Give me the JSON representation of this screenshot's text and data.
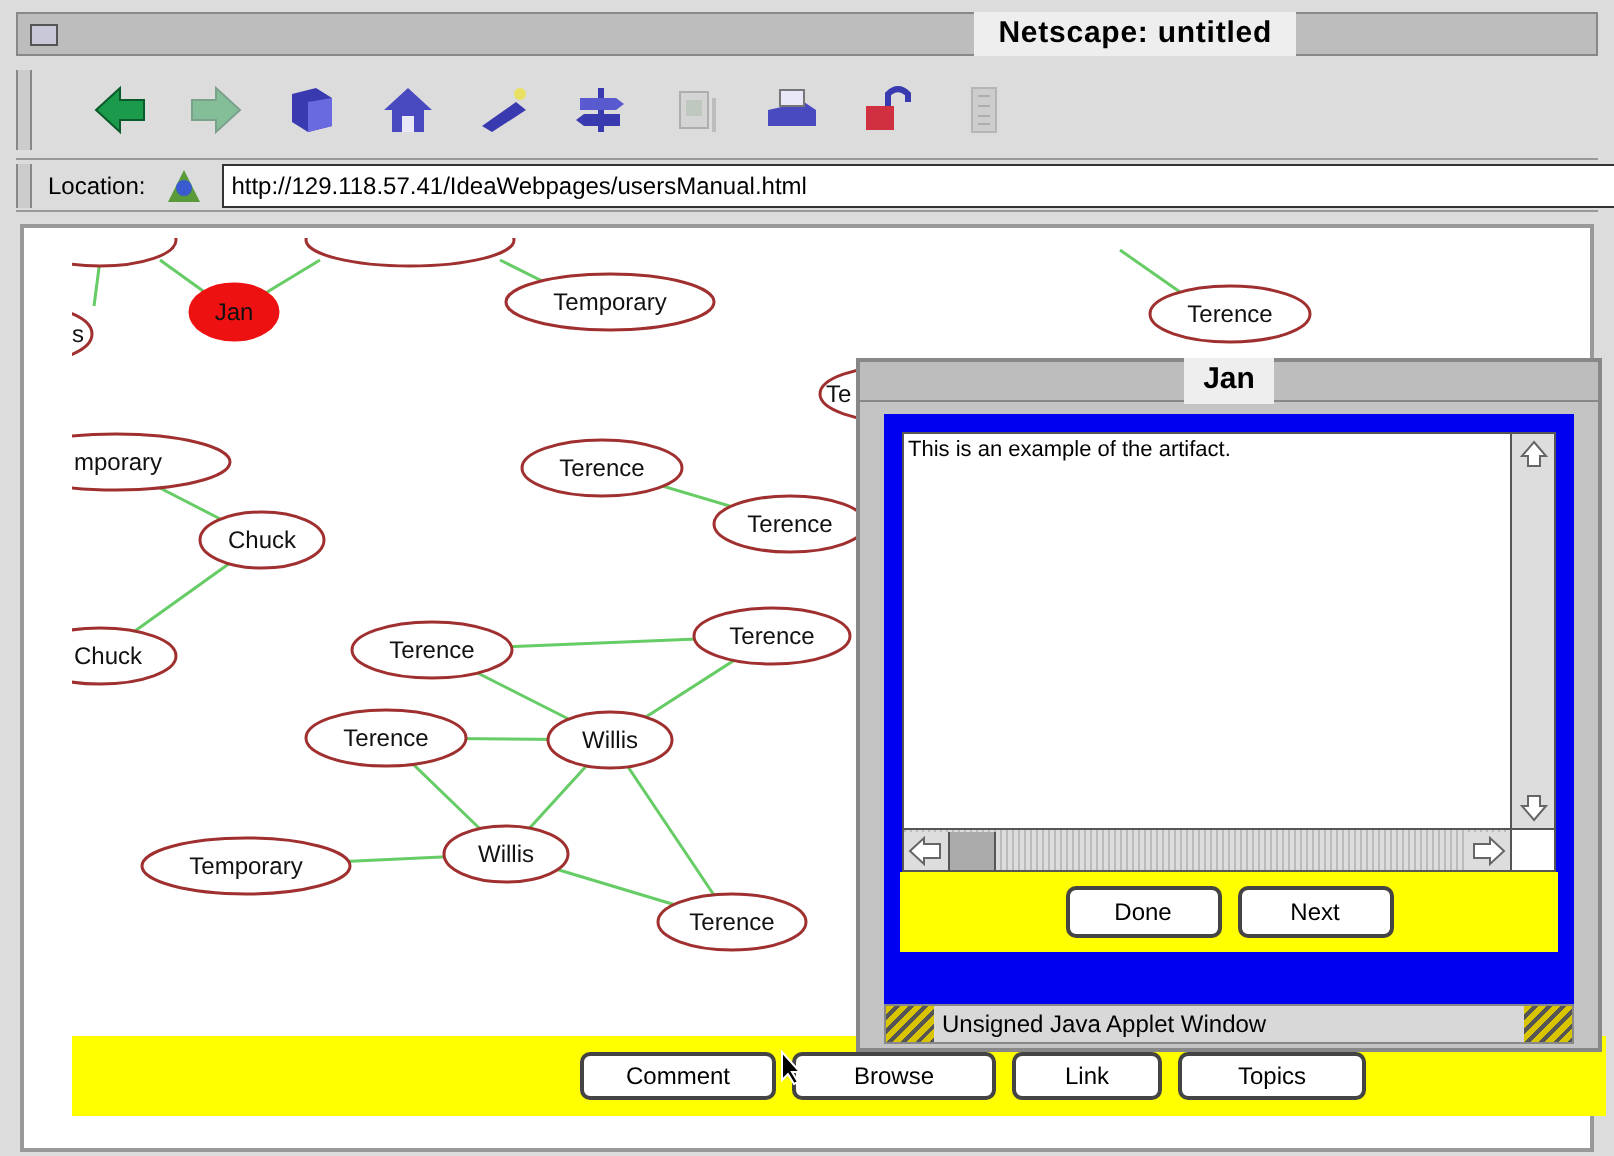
{
  "window": {
    "title": "Netscape: untitled"
  },
  "toolbar": [
    {
      "kind": "back",
      "disabled": false
    },
    {
      "kind": "forward",
      "disabled": true
    },
    {
      "kind": "reload",
      "disabled": false
    },
    {
      "kind": "home",
      "disabled": false
    },
    {
      "kind": "search",
      "disabled": false
    },
    {
      "kind": "guide",
      "disabled": false
    },
    {
      "kind": "images",
      "disabled": true
    },
    {
      "kind": "print",
      "disabled": false
    },
    {
      "kind": "security",
      "disabled": false
    },
    {
      "kind": "stop",
      "disabled": true
    }
  ],
  "location": {
    "label": "Location:",
    "value": "http://129.118.57.41/IdeaWebpages/usersManual.html"
  },
  "graph": {
    "nodes": [
      {
        "label": "s",
        "selected": false
      },
      {
        "label": "Jan",
        "selected": true
      },
      {
        "label": "Temporary",
        "selected": false
      },
      {
        "label": "Terence",
        "selected": false
      },
      {
        "label": "Te",
        "selected": false
      },
      {
        "label": "mporary",
        "selected": false
      },
      {
        "label": "Chuck",
        "selected": false
      },
      {
        "label": "Chuck",
        "selected": false
      },
      {
        "label": "Terence",
        "selected": false
      },
      {
        "label": "Terence",
        "selected": false
      },
      {
        "label": "Terence",
        "selected": false
      },
      {
        "label": "Terence",
        "selected": false
      },
      {
        "label": "Terence",
        "selected": false
      },
      {
        "label": "Willis",
        "selected": false
      },
      {
        "label": "Temporary",
        "selected": false
      },
      {
        "label": "Willis",
        "selected": false
      },
      {
        "label": "Terence",
        "selected": false
      }
    ]
  },
  "buttons": [
    "Comment",
    "Browse",
    "Link",
    "Topics"
  ],
  "dialog": {
    "title": "Jan",
    "text": "This is an example of the artifact.",
    "buttons": [
      "Done",
      "Next"
    ],
    "status": "Unsigned Java Applet Window"
  }
}
